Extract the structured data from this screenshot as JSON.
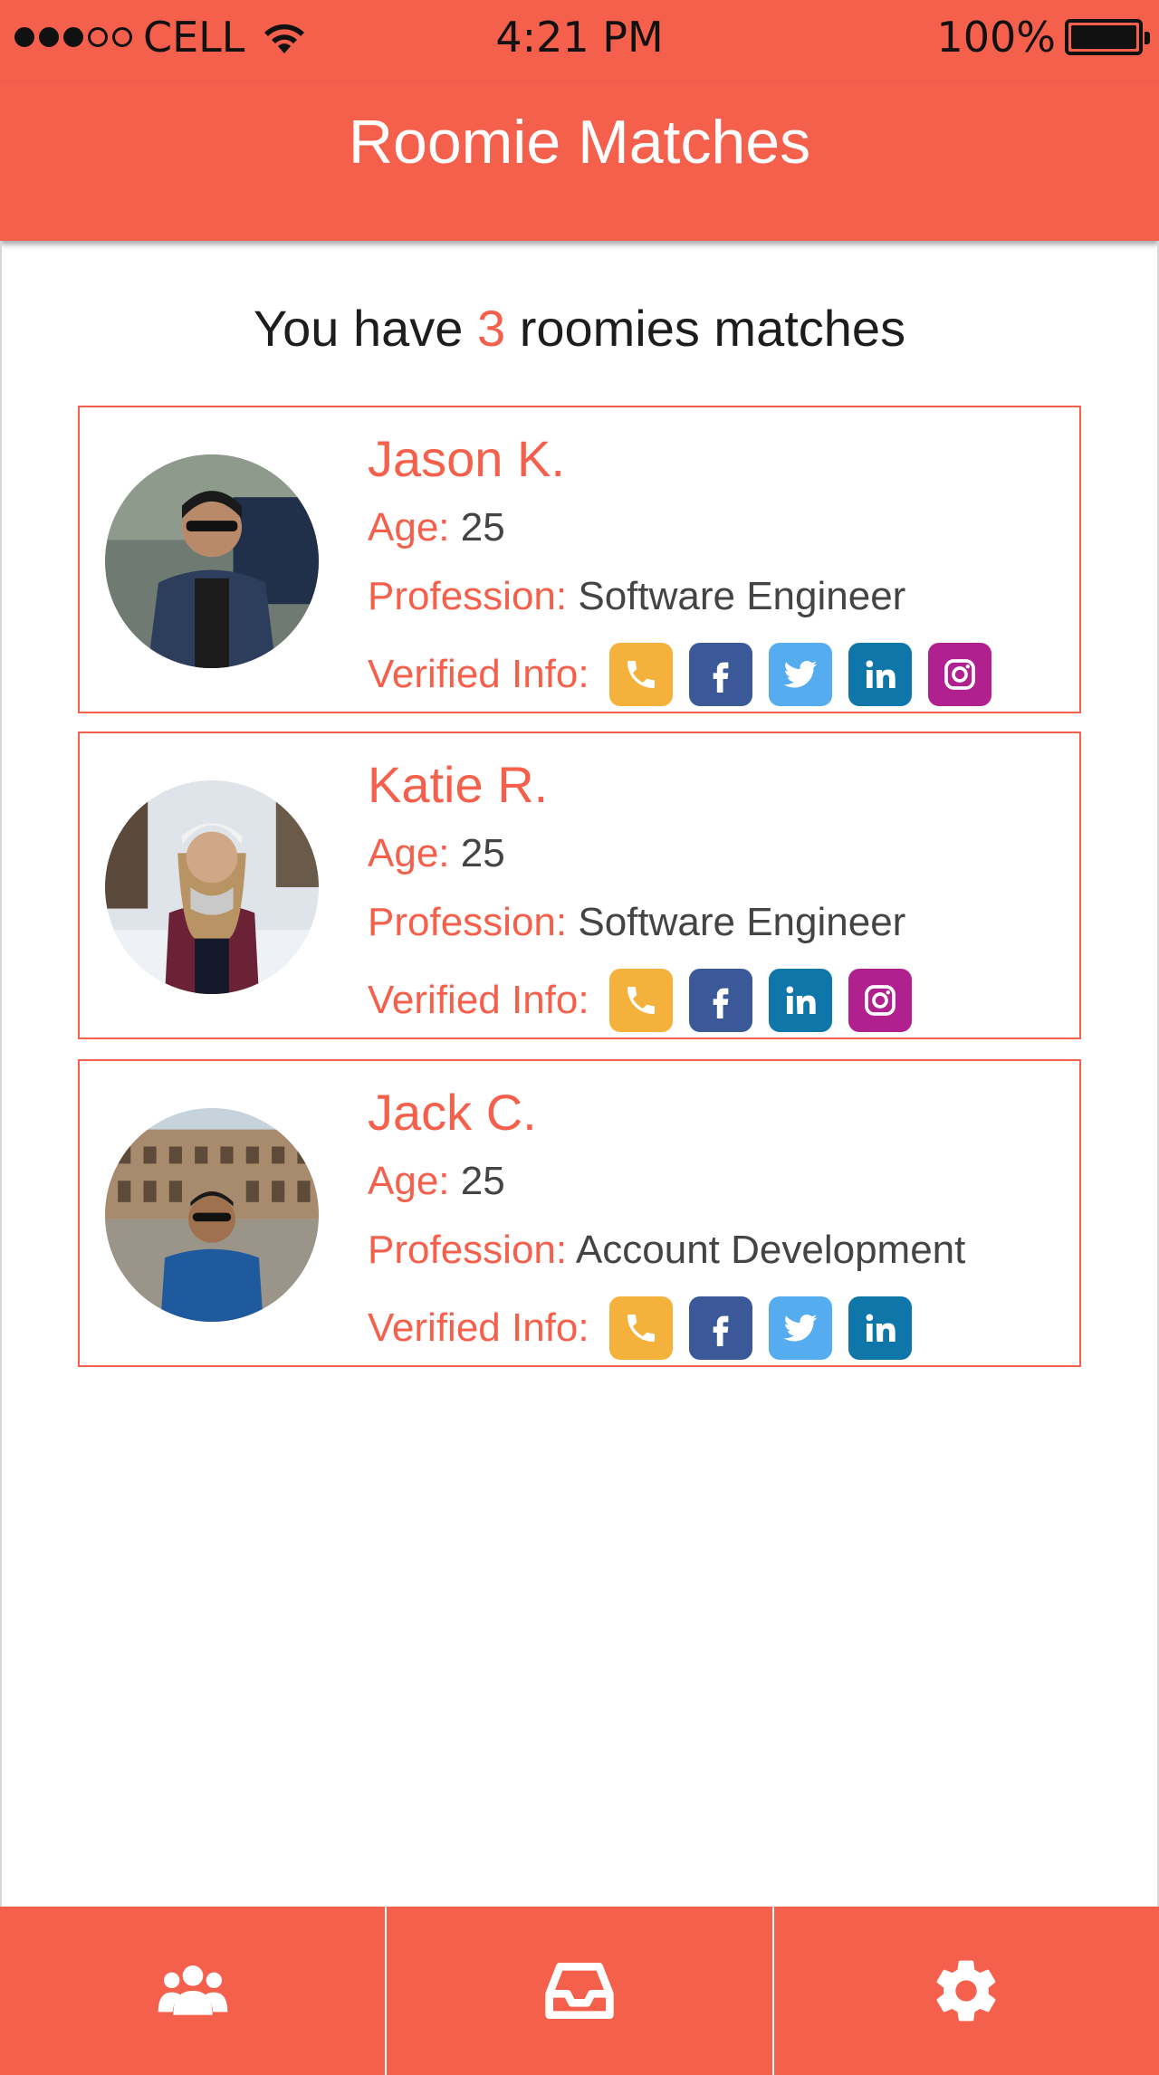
{
  "status_bar": {
    "carrier": "CELL",
    "time": "4:21 PM",
    "battery": "100%",
    "signal_bars_filled": 3,
    "signal_bars_total": 5,
    "battery_level": 1.0
  },
  "header": {
    "title": "Roomie Matches"
  },
  "summary": {
    "prefix": "You have",
    "count": "3",
    "suffix": "roomies matches"
  },
  "colors": {
    "accent": "#f4604c",
    "phone": "#f4b23c",
    "facebook": "#3b5998",
    "twitter": "#55acee",
    "linkedin": "#0e76a8",
    "instagram": "#b0208e"
  },
  "matches": [
    {
      "name": "Jason K.",
      "age_label": "Age:",
      "age": "25",
      "profession_label": "Profession:",
      "profession": "Software Engineer",
      "verified_label": "Verified Info:",
      "verified": [
        "phone-icon",
        "facebook-icon",
        "twitter-icon",
        "linkedin-icon",
        "instagram-icon"
      ]
    },
    {
      "name": "Katie R.",
      "age_label": "Age:",
      "age": "25",
      "profession_label": "Profession:",
      "profession": "Software Engineer",
      "verified_label": "Verified Info:",
      "verified": [
        "phone-icon",
        "facebook-icon",
        "linkedin-icon",
        "instagram-icon"
      ]
    },
    {
      "name": "Jack C.",
      "age_label": "Age:",
      "age": "25",
      "profession_label": "Profession:",
      "profession": "Account Development",
      "verified_label": "Verified Info:",
      "verified": [
        "phone-icon",
        "facebook-icon",
        "twitter-icon",
        "linkedin-icon"
      ]
    }
  ],
  "tabs": [
    {
      "icon": "group-icon"
    },
    {
      "icon": "inbox-icon"
    },
    {
      "icon": "gear-icon"
    }
  ]
}
